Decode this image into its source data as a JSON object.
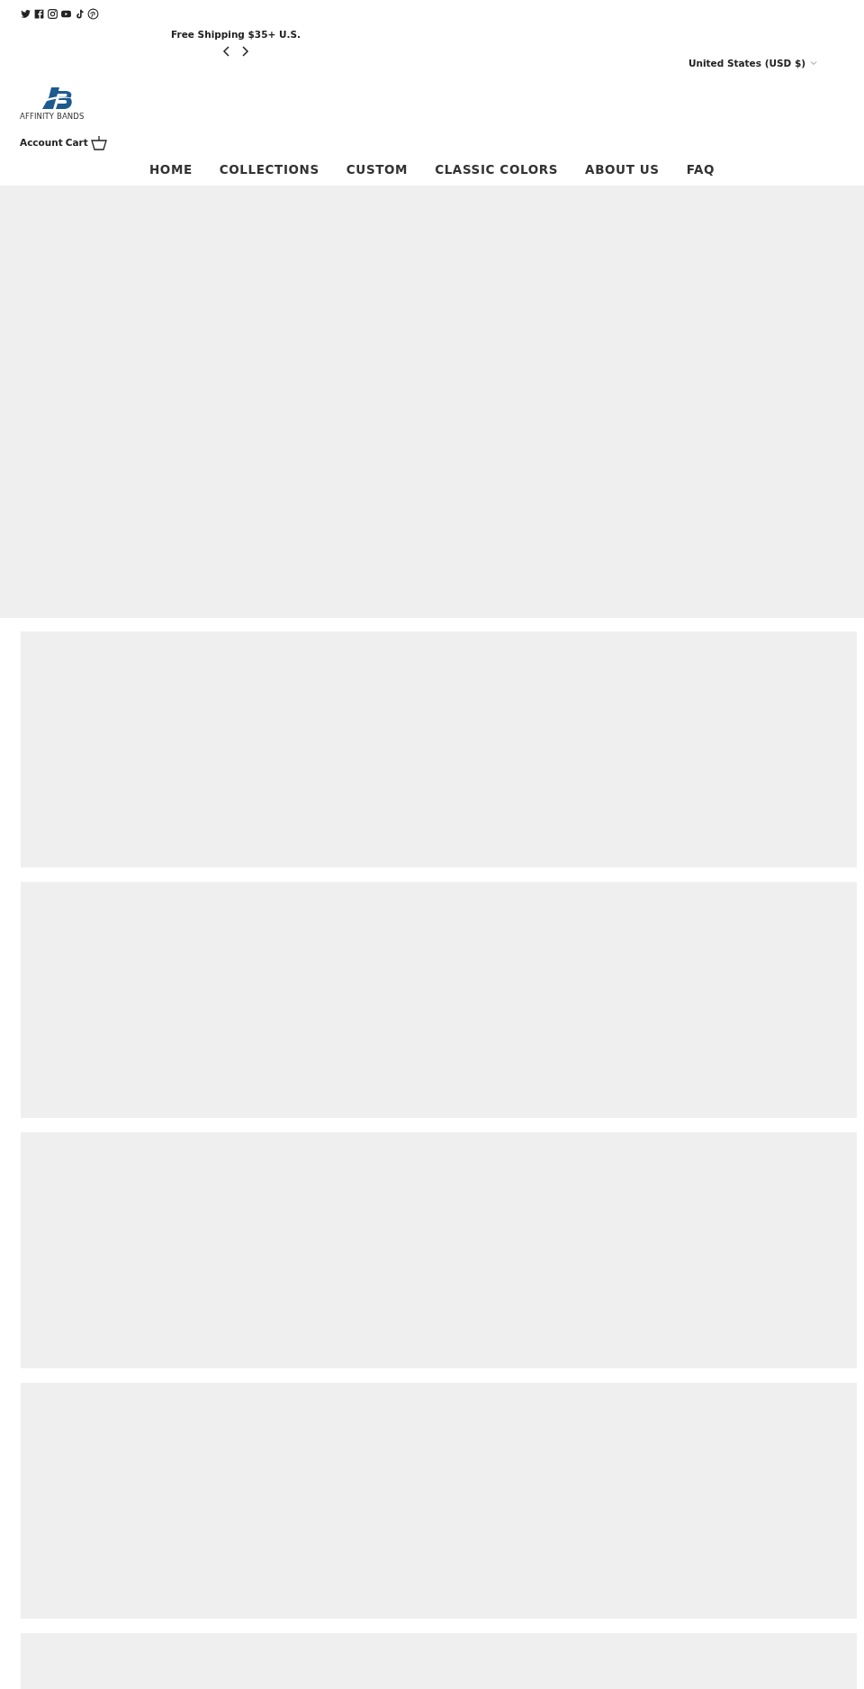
{
  "social_links": [
    {
      "kind": "twitter"
    },
    {
      "kind": "facebook"
    },
    {
      "kind": "instagram"
    },
    {
      "kind": "youtube"
    },
    {
      "kind": "tiktok"
    },
    {
      "kind": "pinterest"
    }
  ],
  "announcement": {
    "text": "Free Shipping $35+ U.S."
  },
  "currency_selector": {
    "label": "United States (USD $)"
  },
  "logo": {
    "text": "AFFINITY BANDS"
  },
  "header_links": [
    {
      "label": "Account",
      "kind": "account"
    },
    {
      "label": "Cart",
      "kind": "cart"
    }
  ],
  "nav": {
    "items": [
      {
        "label": "HOME"
      },
      {
        "label": "COLLECTIONS"
      },
      {
        "label": "CUSTOM"
      },
      {
        "label": "CLASSIC COLORS"
      },
      {
        "label": "ABOUT US"
      },
      {
        "label": "FAQ"
      }
    ]
  },
  "hero": {
    "kind": "placeholder"
  },
  "sections": [
    {
      "kind": "placeholder"
    },
    {
      "kind": "placeholder"
    },
    {
      "kind": "placeholder"
    },
    {
      "kind": "placeholder"
    },
    {
      "kind": "placeholder"
    }
  ]
}
